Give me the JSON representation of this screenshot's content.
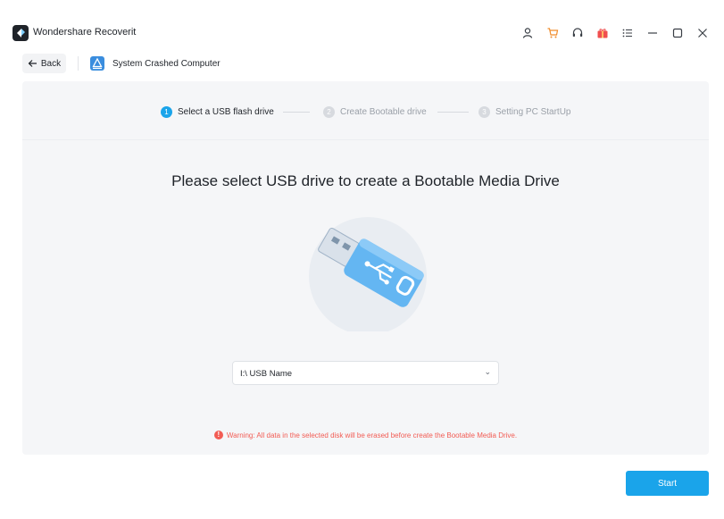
{
  "window": {
    "app_title": "Wondershare Recoverit",
    "icons": [
      "user-icon",
      "cart-icon",
      "headset-icon",
      "gift-icon",
      "list-menu-icon",
      "minimize-icon",
      "maximize-icon",
      "close-icon"
    ]
  },
  "toolbar": {
    "back_label": "Back",
    "mode_title": "System Crashed Computer"
  },
  "steps": [
    {
      "number": "1",
      "label": "Select a USB flash drive",
      "active": true
    },
    {
      "number": "2",
      "label": "Create Bootable drive",
      "active": false
    },
    {
      "number": "3",
      "label": "Setting PC StartUp",
      "active": false
    }
  ],
  "main": {
    "headline": "Please select USB drive to create a Bootable Media Drive",
    "usb_select_value": "I:\\ USB Name",
    "warning": "Warning: All data in the selected disk will be erased before create the Bootable Media Drive."
  },
  "footer": {
    "start_label": "Start"
  },
  "colors": {
    "accent": "#1aa4ea",
    "warning": "#f25c54",
    "cart": "#f08c2b",
    "gift": "#f04e4e"
  }
}
